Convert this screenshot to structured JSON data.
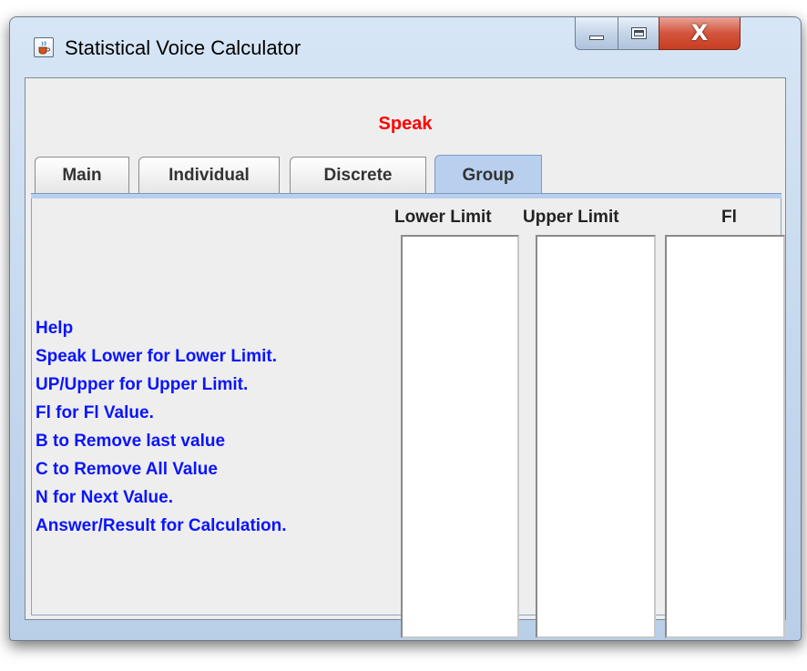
{
  "window": {
    "title": "Statistical Voice Calculator",
    "app_icon": "java-cup-icon",
    "controls": {
      "minimize_icon": "minimize-icon",
      "maximize_icon": "maximize-icon",
      "close_icon": "close-icon",
      "close_glyph": "X"
    }
  },
  "status": {
    "label": "Speak",
    "color": "#ff0000"
  },
  "tabs": [
    {
      "label": "Main",
      "selected": false
    },
    {
      "label": "Individual",
      "selected": false
    },
    {
      "label": "Discrete",
      "selected": false
    },
    {
      "label": "Group",
      "selected": true
    }
  ],
  "group_panel": {
    "columns": [
      {
        "header": "Lower Limit",
        "values": []
      },
      {
        "header": "Upper Limit",
        "values": []
      },
      {
        "header": "Fl",
        "values": []
      }
    ],
    "help": {
      "title": "Help",
      "color": "#0a14ff",
      "lines": [
        "Speak Lower for Lower Limit.",
        "UP/Upper for Upper Limit.",
        "Fl for Fl Value.",
        "B to Remove last value",
        "C to Remove All Value",
        "N for Next Value.",
        "Answer/Result for Calculation."
      ]
    }
  }
}
